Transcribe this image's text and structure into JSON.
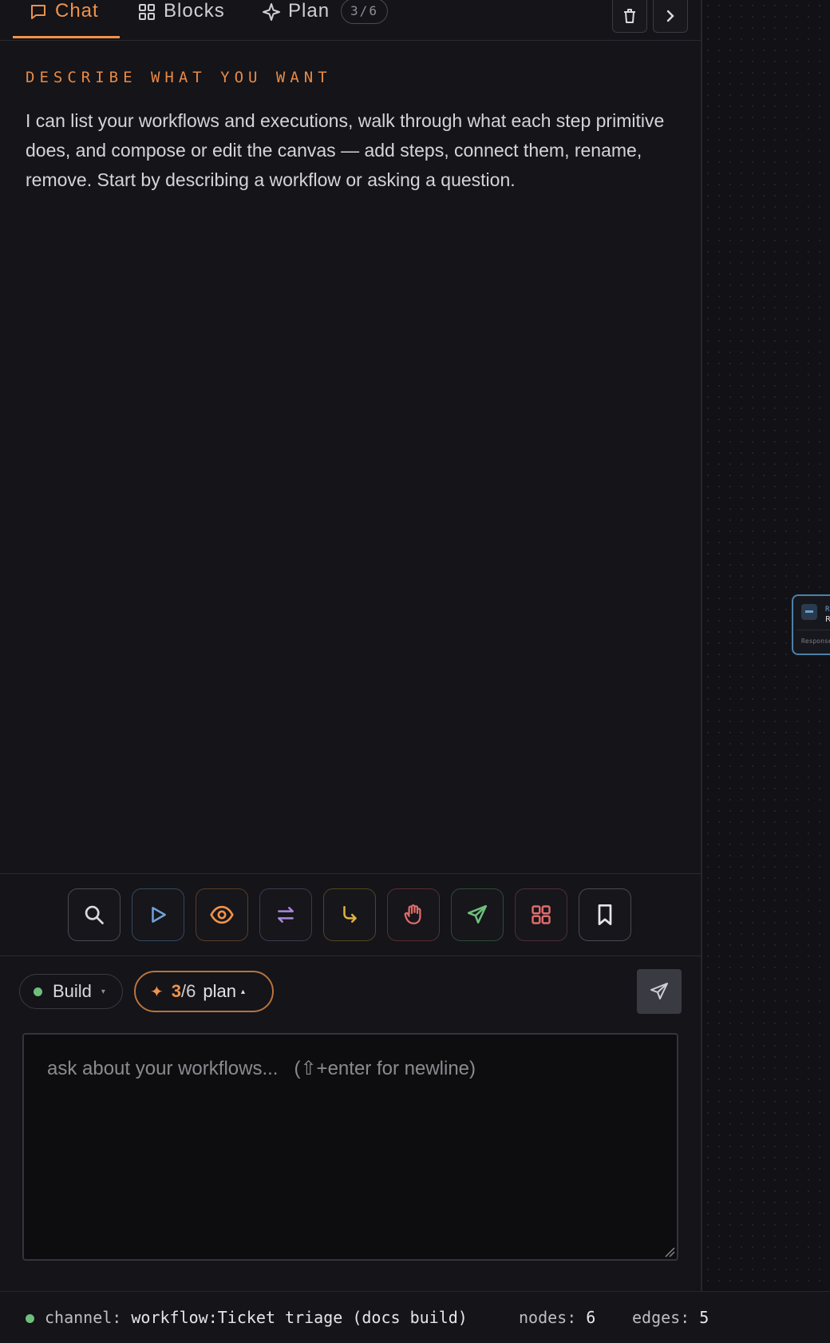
{
  "tabs": {
    "chat": "Chat",
    "blocks": "Blocks",
    "plan": "Plan",
    "plan_count": "3/6"
  },
  "chat": {
    "section_label": "DESCRIBE WHAT YOU WANT",
    "intro": "I can list your workflows and executions, walk through what each step primitive does, and compose or edit the canvas — add steps, connect them, rename, remove. Start by describing a workflow or asking a question."
  },
  "toolbar": {
    "tools": [
      {
        "icon": "search-icon",
        "color": "#d9d9de"
      },
      {
        "icon": "play-icon",
        "color": "#6fa3d8"
      },
      {
        "icon": "eye-icon",
        "color": "#f0924a"
      },
      {
        "icon": "swap-icon",
        "color": "#a98ad8"
      },
      {
        "icon": "branch-icon",
        "color": "#e0b341"
      },
      {
        "icon": "hand-icon",
        "color": "#e06b6b"
      },
      {
        "icon": "send-icon",
        "color": "#6fbf7c"
      },
      {
        "icon": "grid-icon",
        "color": "#e06b6b"
      },
      {
        "icon": "bookmark-icon",
        "color": "#e6e6ea"
      }
    ]
  },
  "composer": {
    "mode": "Build",
    "plan_done": "3",
    "plan_total": "/6",
    "plan_word": "plan",
    "placeholder": "ask about your workflows...   (⇧+enter for newline)"
  },
  "status": {
    "channel_label": "channel:",
    "channel_value": "workflow:Ticket triage (docs build)",
    "nodes_label": "nodes:",
    "nodes_value": "6",
    "edges_label": "edges:",
    "edges_value": "5"
  },
  "canvas": {
    "node_type": "RE",
    "node_name": "R",
    "node_footer": "Response"
  },
  "colors": {
    "accent": "#f0924a",
    "status_ok": "#6fbf7c"
  }
}
